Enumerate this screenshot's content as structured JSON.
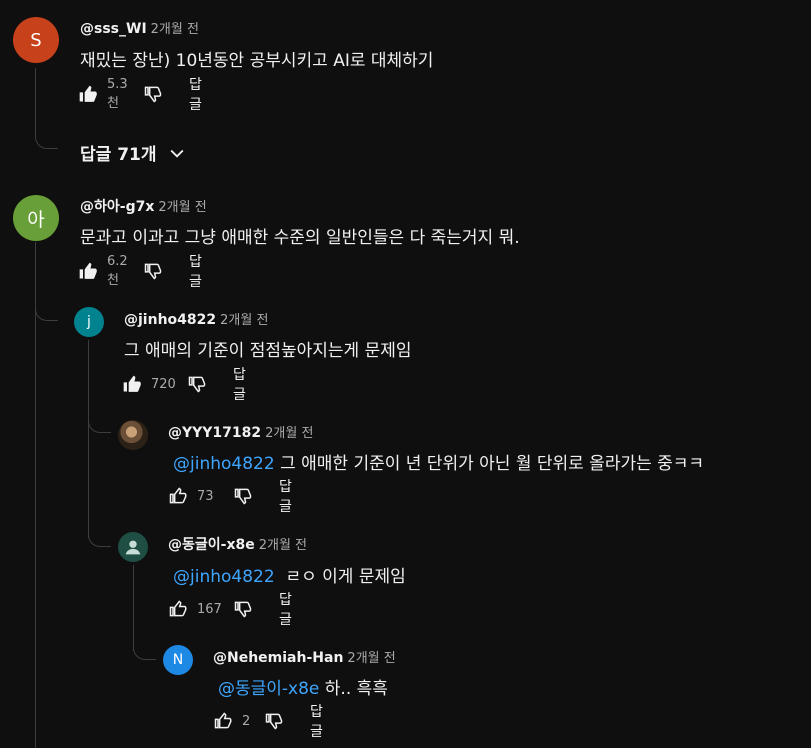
{
  "comments": [
    {
      "avatar": {
        "letter": "S",
        "color": "#c7411a"
      },
      "author": "@sss_WI",
      "time": "2개월 전",
      "mention": "",
      "text": "재밌는 장난) 10년동안 공부시키고 AI로 대체하기",
      "likes": "5.3천",
      "reply_label": "답글",
      "replies_toggle": "답글 71개"
    },
    {
      "avatar": {
        "letter": "아",
        "color": "#689f38"
      },
      "author": "@하아-g7x",
      "time": "2개월 전",
      "mention": "",
      "text": "문과고 이과고 그냥 애매한 수준의 일반인들은 다 죽는거지 뭐.",
      "likes": "6.2천",
      "reply_label": "답글"
    },
    {
      "avatar": {
        "letter": "j",
        "color": "#00838f"
      },
      "author": "@jinho4822",
      "time": "2개월 전",
      "mention": "",
      "text": "그 애매의 기준이 점점높아지는게 문제임",
      "likes": "720",
      "reply_label": "답글"
    },
    {
      "avatar": {
        "letter": "",
        "color": "#5b4a3a"
      },
      "author": "@YYY17182",
      "time": "2개월 전",
      "mention": "@jinho4822",
      "text": " 그 애매한 기준이 년 단위가 아닌 월 단위로 올라가는 중ㅋㅋ",
      "likes": "73",
      "reply_label": "답글"
    },
    {
      "avatar": {
        "letter": "",
        "color": "#1f4f44"
      },
      "author": "@동글이-x8e",
      "time": "2개월 전",
      "mention": "@jinho4822",
      "text": "  ㄹㅇ 이게 문제임",
      "likes": "167",
      "reply_label": "답글"
    },
    {
      "avatar": {
        "letter": "N",
        "color": "#1e88e5"
      },
      "author": "@Nehemiah-Han",
      "time": "2개월 전",
      "mention": "@동글이-x8e",
      "text": " 하.. 흑흑",
      "likes": "2",
      "reply_label": "답글"
    }
  ]
}
